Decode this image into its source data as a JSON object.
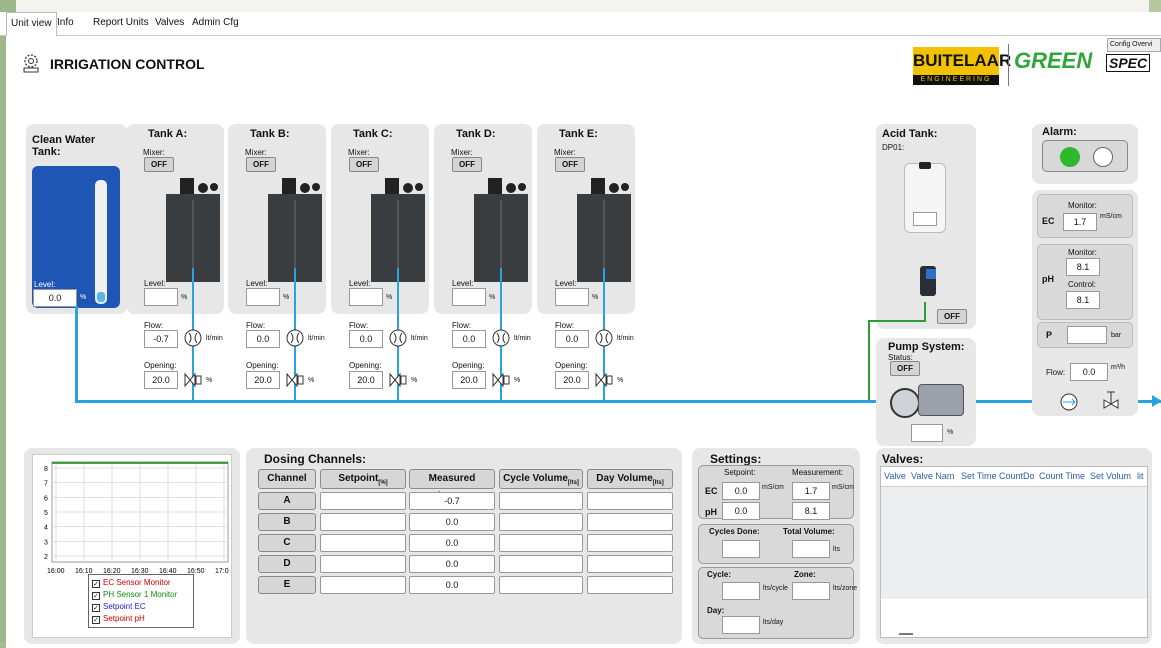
{
  "tabs": [
    "Unit view",
    "Info",
    "Report Units",
    "Valves",
    "Admin Cfg"
  ],
  "header": {
    "title": "IRRIGATION CONTROL",
    "logo1": "BUITELAAR",
    "logo1_sub": "ENGINEERING",
    "logo2a": "GREEN",
    "logo2b": "SPEC",
    "config_button": "Config Overvi"
  },
  "clean_tank": {
    "title": "Clean Water Tank:",
    "level_label": "Level:",
    "level_value": "0.0",
    "level_unit": "%"
  },
  "tanks": [
    {
      "title": "Tank A:",
      "mixer_label": "Mixer:",
      "mixer_state": "OFF",
      "level_label": "Level:",
      "level_value": "",
      "flow_label": "Flow:",
      "flow_value": "-0.7",
      "opening_label": "Opening:",
      "opening_value": "20.0"
    },
    {
      "title": "Tank B:",
      "mixer_label": "Mixer:",
      "mixer_state": "OFF",
      "level_label": "Level:",
      "level_value": "",
      "flow_label": "Flow:",
      "flow_value": "0.0",
      "opening_label": "Opening:",
      "opening_value": "20.0"
    },
    {
      "title": "Tank C:",
      "mixer_label": "Mixer:",
      "mixer_state": "OFF",
      "level_label": "Level:",
      "level_value": "",
      "flow_label": "Flow:",
      "flow_value": "0.0",
      "opening_label": "Opening:",
      "opening_value": "20.0"
    },
    {
      "title": "Tank D:",
      "mixer_label": "Mixer:",
      "mixer_state": "OFF",
      "level_label": "Level:",
      "level_value": "",
      "flow_label": "Flow:",
      "flow_value": "0.0",
      "opening_label": "Opening:",
      "opening_value": "20.0"
    },
    {
      "title": "Tank E:",
      "mixer_label": "Mixer:",
      "mixer_state": "OFF",
      "level_label": "Level:",
      "level_value": "",
      "flow_label": "Flow:",
      "flow_value": "0.0",
      "opening_label": "Opening:",
      "opening_value": "20.0"
    }
  ],
  "units": {
    "percent": "%",
    "flow": "lt/min",
    "flow_a": "lt",
    "flow_b": "min",
    "ec_a": "mS",
    "ec_b": "cm",
    "bar": "bar",
    "m3h_a": "m³",
    "m3h_b": "h",
    "lts": "lts",
    "lts_cycle_a": "lts",
    "lts_cycle_b": "cycle",
    "lts_zone_a": "lts",
    "lts_zone_b": "zone",
    "lts_day_a": "lts",
    "lts_day_b": "day"
  },
  "acid_tank": {
    "title": "Acid Tank:",
    "subtitle": "DP01:",
    "state": "OFF"
  },
  "pump": {
    "title": "Pump System:",
    "status_label": "Status:",
    "state": "OFF",
    "value": ""
  },
  "alarm": {
    "title": "Alarm:"
  },
  "monitor": {
    "ec_label": "EC",
    "ec_monitor_label": "Monitor:",
    "ec_value": "1.7",
    "ph_label": "pH",
    "ph_monitor_label": "Monitor:",
    "ph_monitor_value": "8.1",
    "ph_control_label": "Control:",
    "ph_control_value": "8.1",
    "p_label": "P",
    "p_value": "",
    "flow_label": "Flow:",
    "flow_value": "0.0"
  },
  "trend": {
    "y_ticks": [
      "8",
      "7",
      "6",
      "5",
      "4",
      "3",
      "2"
    ],
    "x_ticks": [
      "16:00",
      "16:10",
      "16:20",
      "16:30",
      "16:40",
      "16:50",
      "17:0"
    ],
    "legend": [
      {
        "label": "EC Sensor Monitor",
        "color": "#d00000"
      },
      {
        "label": "PH Sensor 1 Monitor",
        "color": "#118a11"
      },
      {
        "label": "Setpoint EC",
        "color": "#1a1ad0"
      },
      {
        "label": "Setpoint pH",
        "color": "#d00000"
      }
    ]
  },
  "dosing": {
    "title": "Dosing Channels:",
    "headers": [
      "Channel",
      "Setpoint",
      "Measured Flow",
      "Cycle Volume",
      "Day Volume"
    ],
    "header_units": [
      "",
      "[%]",
      "[l/min]",
      "[lts]",
      "[lts]"
    ],
    "rows": [
      {
        "channel": "A",
        "setpoint": "",
        "measured": "-0.7",
        "cycle": "",
        "day": ""
      },
      {
        "channel": "B",
        "setpoint": "",
        "measured": "0.0",
        "cycle": "",
        "day": ""
      },
      {
        "channel": "C",
        "setpoint": "",
        "measured": "0.0",
        "cycle": "",
        "day": ""
      },
      {
        "channel": "D",
        "setpoint": "",
        "measured": "0.0",
        "cycle": "",
        "day": ""
      },
      {
        "channel": "E",
        "setpoint": "",
        "measured": "0.0",
        "cycle": "",
        "day": ""
      }
    ]
  },
  "settings": {
    "title": "Settings:",
    "setpoint_label": "Setpoint:",
    "measurement_label": "Measurement:",
    "ec_label": "EC",
    "ec_setpoint": "0.0",
    "ec_measurement": "1.7",
    "ph_label": "pH",
    "ph_setpoint": "0.0",
    "ph_measurement": "8.1",
    "cycles_done_label": "Cycles Done:",
    "total_volume_label": "Total Volume:",
    "cycle_label": "Cycle:",
    "zone_label": "Zone:",
    "day_label": "Day:"
  },
  "valves": {
    "title": "Valves:",
    "columns": [
      "Valve",
      "Valve Nam",
      "Set Time",
      "CountDo",
      "Count Time",
      "Set Volum",
      "lit"
    ]
  }
}
